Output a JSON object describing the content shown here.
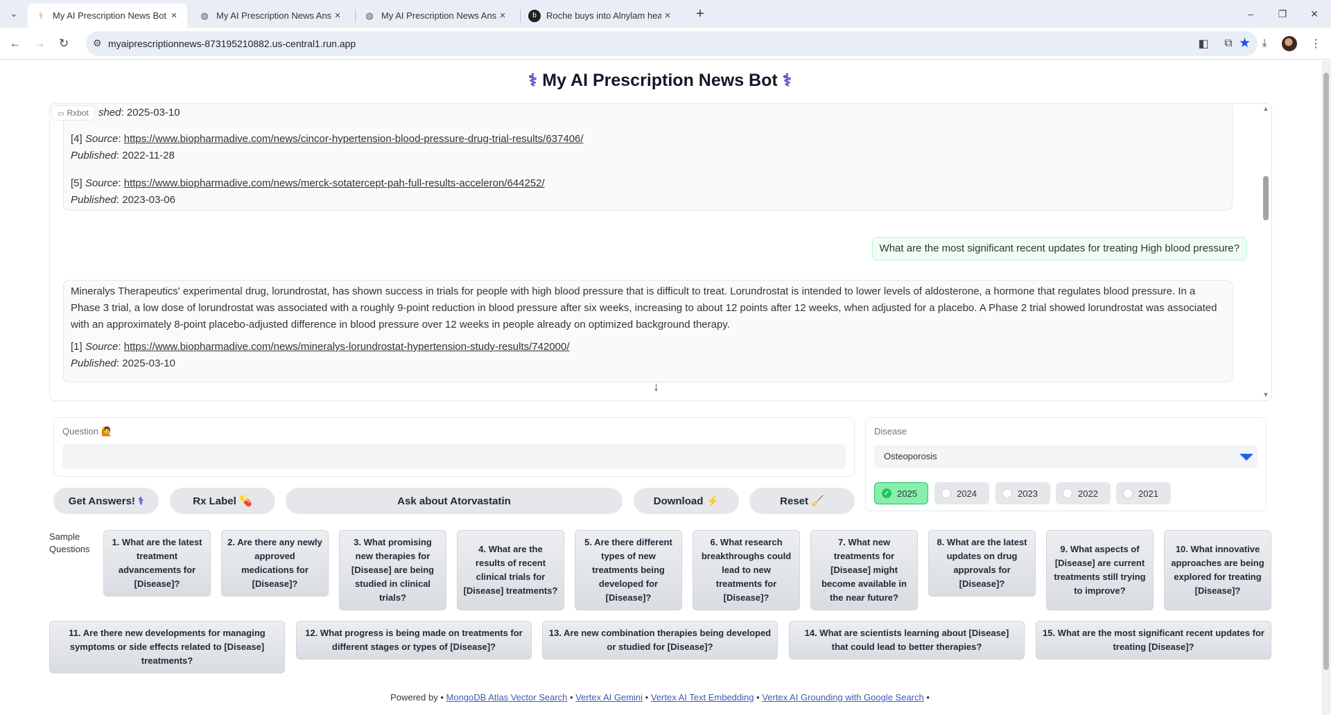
{
  "browser": {
    "tabs": [
      {
        "title": "My AI Prescription News Bot",
        "active": true
      },
      {
        "title": "My AI Prescription News Answ",
        "active": false
      },
      {
        "title": "My AI Prescription News Answ",
        "active": false
      },
      {
        "title": "Roche buys into Alnylam heart",
        "active": false
      }
    ],
    "url": "myaiprescriptionnews-873195210882.us-central1.run.app",
    "new_tab": "+",
    "window_controls": [
      "–",
      "❐",
      "✕"
    ]
  },
  "app": {
    "title": "My AI Prescription News Bot",
    "title_icon": "stethoscope-icon",
    "chat_label": "Rxbot",
    "messages": {
      "top_partial": {
        "published_label": "shed",
        "published_value": "2025-03-10"
      },
      "sources_top": [
        {
          "num": "[4]",
          "source_label": "Source",
          "url": "https://www.biopharmadive.com/news/cincor-hypertension-blood-pressure-drug-trial-results/637406/",
          "published_label": "Published",
          "date": "2022-11-28"
        },
        {
          "num": "[5]",
          "source_label": "Source",
          "url": "https://www.biopharmadive.com/news/merck-sotatercept-pah-full-results-acceleron/644252/",
          "published_label": "Published",
          "date": "2023-03-06"
        }
      ],
      "user_question": "What are the most significant recent updates for treating High blood pressure?",
      "answer": "Mineralys Therapeutics' experimental drug, lorundrostat, has shown success in trials for people with high blood pressure that is difficult to treat. Lorundrostat is intended to lower levels of aldosterone, a hormone that regulates blood pressure. In a Phase 3 trial, a low dose of lorundrostat was associated with a roughly 9-point reduction in blood pressure after six weeks, increasing to about 12 points after 12 weeks, when adjusted for a placebo. A Phase 2 trial showed lorundrostat was associated with an approximately 8-point placebo-adjusted difference in blood pressure over 12 weeks in people already on optimized background therapy.",
      "answer_sources": [
        {
          "num": "[1]",
          "source_label": "Source",
          "url": "https://www.biopharmadive.com/news/mineralys-lorundrostat-hypertension-study-results/742000/",
          "published_label": "Published",
          "date": "2025-03-10"
        }
      ]
    },
    "question": {
      "label": "Question",
      "label_icon": "raised-hand-emoji",
      "value": "",
      "placeholder": ""
    },
    "buttons": {
      "get_answers": "Get Answers!",
      "rx_label": "Rx Label",
      "ask_about": "Ask about Atorvastatin",
      "download": "Download",
      "reset": "Reset"
    },
    "disease": {
      "label": "Disease",
      "selected": "Osteoporosis"
    },
    "years": [
      {
        "label": "2025",
        "checked": true
      },
      {
        "label": "2024",
        "checked": false
      },
      {
        "label": "2023",
        "checked": false
      },
      {
        "label": "2022",
        "checked": false
      },
      {
        "label": "2021",
        "checked": false
      }
    ],
    "samples_label": "Sample Questions",
    "sample_questions": [
      "1. What are the latest treatment advancements for [Disease]?",
      "2. Are there any newly approved medications for [Disease]?",
      "3. What promising new therapies for [Disease] are being studied in clinical trials?",
      "4. What are the results of recent clinical trials for [Disease] treatments?",
      "5. Are there different types of new treatments being developed for [Disease]?",
      "6. What research breakthroughs could lead to new treatments for [Disease]?",
      "7. What new treatments for [Disease] might become available in the near future?",
      "8. What are the latest updates on drug approvals for [Disease]?",
      "9. What aspects of [Disease] are current treatments still trying to improve?",
      "10. What innovative approaches are being explored for treating [Disease]?",
      "11. Are there new developments for managing symptoms or side effects related to [Disease] treatments?",
      "12. What progress is being made on treatments for different stages or types of [Disease]?",
      "13. Are new combination therapies being developed or studied for [Disease]?",
      "14. What are scientists learning about [Disease] that could lead to better therapies?",
      "15. What are the most significant recent updates for treating [Disease]?"
    ],
    "footer": {
      "prefix": "Powered by •",
      "links": [
        "MongoDB Atlas Vector Search",
        "Vertex AI Gemini",
        "Vertex AI Text Embedding",
        "Vertex AI Grounding with Google Search"
      ],
      "sep": "•"
    }
  },
  "colors": {
    "accent_green": "#22c55e",
    "link_blue": "#3b5bb5",
    "star_blue": "#1a56db"
  }
}
